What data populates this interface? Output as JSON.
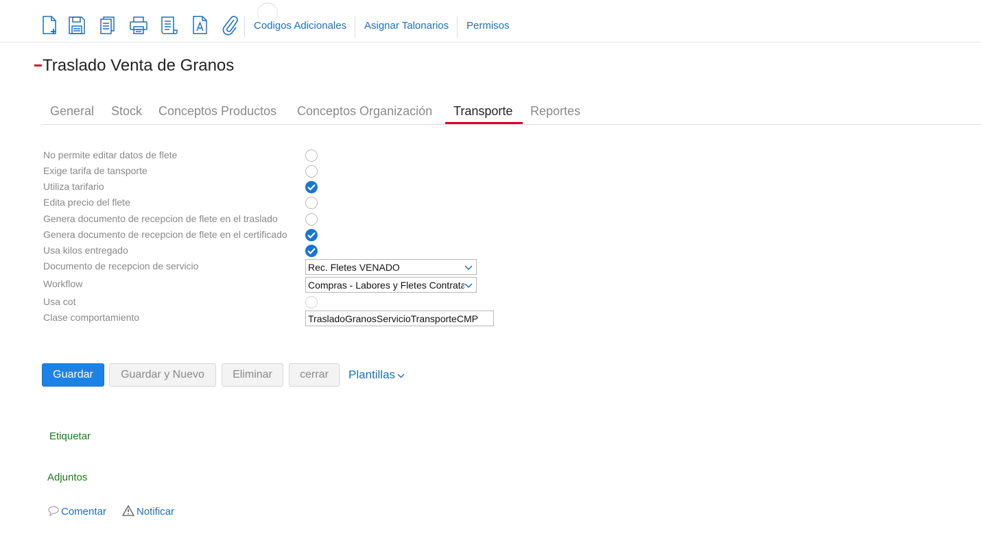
{
  "toolbar": {
    "icons": [
      "new-document-icon",
      "save-icon",
      "copy-icon",
      "print-icon",
      "list-report-icon",
      "text-document-icon",
      "paperclip-icon"
    ],
    "links": [
      "Codigos Adicionales",
      "Asignar Talonarios",
      "Permisos"
    ]
  },
  "page": {
    "title": "Traslado Venta de Granos"
  },
  "tabs": [
    {
      "label": "General"
    },
    {
      "label": "Stock"
    },
    {
      "label": "Conceptos Productos"
    },
    {
      "label": "Conceptos Organización"
    },
    {
      "label": "Transporte",
      "active": true
    },
    {
      "label": "Reportes"
    }
  ],
  "form": {
    "fields": [
      {
        "label": "No permite editar datos de flete",
        "type": "checkbox",
        "checked": false
      },
      {
        "label": "Exige tarifa de tansporte",
        "type": "checkbox",
        "checked": false
      },
      {
        "label": "Utiliza tarifario",
        "type": "checkbox",
        "checked": true
      },
      {
        "label": "Edita precio del flete",
        "type": "checkbox",
        "checked": false
      },
      {
        "label": "Genera documento de recepcion de flete en el traslado",
        "type": "checkbox",
        "checked": false
      },
      {
        "label": "Genera documento de recepcion de flete en el certificado",
        "type": "checkbox",
        "checked": true
      },
      {
        "label": "Usa kilos entregado",
        "type": "checkbox",
        "checked": true
      },
      {
        "label": "Documento de recepcion de servicio",
        "type": "select",
        "value": "Rec. Fletes VENADO"
      },
      {
        "label": "Workflow",
        "type": "select",
        "value": "Compras - Labores y Fletes Contratados"
      },
      {
        "label": "Usa cot",
        "type": "checkbox",
        "checked": false
      },
      {
        "label": "Clase comportamiento",
        "type": "text",
        "value": "TrasladoGranosServicioTransporteCMP"
      }
    ]
  },
  "actions": {
    "save": "Guardar",
    "save_new": "Guardar y Nuevo",
    "delete": "Eliminar",
    "close": "cerrar",
    "templates": "Plantillas"
  },
  "bottom": {
    "tag": "Etiquetar",
    "attachments": "Adjuntos",
    "comment": "Comentar",
    "notify": "Notificar"
  },
  "colors": {
    "accent": "#e0002a",
    "link": "#1a6fc4",
    "primary": "#1d82e8",
    "green": "#1a7a1a"
  }
}
